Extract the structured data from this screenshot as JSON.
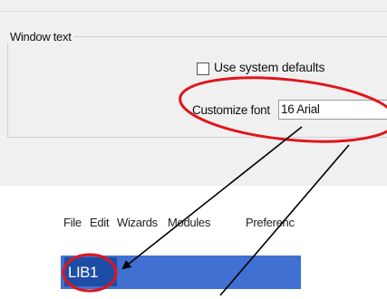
{
  "dialog": {
    "group_title": "Window text",
    "use_system_defaults_label": "Use system defaults",
    "use_system_defaults_checked": false,
    "customize_font_label": "Customize font",
    "customize_font_value": "16 Arial"
  },
  "app": {
    "menu": [
      "File",
      "Edit",
      "Wizards",
      "Modules",
      "Preferenc"
    ],
    "active_document_tab": "LIB1"
  },
  "annotations": {
    "highlight_color": "#e0151c",
    "arrow_color": "#000000"
  }
}
